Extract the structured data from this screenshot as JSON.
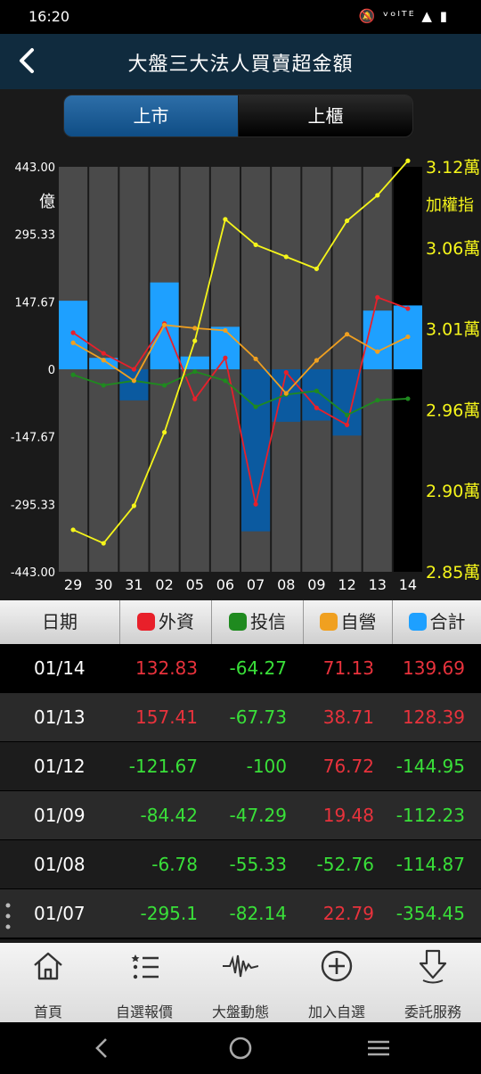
{
  "status": {
    "time": "16:20",
    "icons": "🔕 ᵛᵒˡᵀᴱ ▲ ▮"
  },
  "header": {
    "title": "大盤三大法人買賣超金額"
  },
  "segments": {
    "listed": "上市",
    "otc": "上櫃"
  },
  "chart_data": {
    "type": "bar",
    "categories": [
      "29",
      "30",
      "31",
      "02",
      "05",
      "06",
      "07",
      "08",
      "09",
      "12",
      "13",
      "14"
    ],
    "ylabel": "億",
    "yticks": [
      "443.00",
      "295.33",
      "147.67",
      "0",
      "-147.67",
      "-295.33",
      "-443.00"
    ],
    "ylim": [
      -443,
      443
    ],
    "y2label": "加權指",
    "y2ticks": [
      "3.12萬",
      "3.06萬",
      "3.01萬",
      "2.96萬",
      "2.90萬",
      "2.85萬"
    ],
    "y2lim": [
      28500,
      31200
    ],
    "series": [
      {
        "name": "合計",
        "type": "bar",
        "color": "#1ea0ff",
        "values": [
          150,
          25,
          -68,
          190,
          28,
          93,
          -354.45,
          -114.87,
          -112.23,
          -144.95,
          128.39,
          139.69
        ]
      },
      {
        "name": "外資",
        "type": "line",
        "color": "#e8202a",
        "values": [
          80,
          35,
          0,
          100,
          -65,
          25,
          -295.1,
          -6.78,
          -84.42,
          -121.67,
          157.41,
          132.83
        ]
      },
      {
        "name": "投信",
        "type": "line",
        "color": "#1f8a1f",
        "values": [
          -12,
          -35,
          -25,
          -35,
          -5,
          -25,
          -82.14,
          -55.33,
          -47.29,
          -100,
          -67.73,
          -64.27
        ]
      },
      {
        "name": "自營",
        "type": "line",
        "color": "#f0a020",
        "values": [
          58,
          20,
          -25,
          97,
          90,
          85,
          22.79,
          -52.76,
          19.48,
          76.72,
          38.71,
          71.13
        ]
      },
      {
        "name": "加權指",
        "type": "line",
        "axis": "right",
        "color": "#f5f51a",
        "values": [
          28780,
          28690,
          28940,
          29430,
          30040,
          30850,
          30680,
          30600,
          30520,
          30840,
          31010,
          31240
        ]
      }
    ],
    "highlight_category": "14"
  },
  "table": {
    "headers": [
      {
        "label": "日期"
      },
      {
        "label": "外資",
        "color": "#e8202a"
      },
      {
        "label": "投信",
        "color": "#1f8a1f"
      },
      {
        "label": "自營",
        "color": "#f0a020"
      },
      {
        "label": "合計",
        "color": "#1ea0ff"
      }
    ],
    "rows": [
      {
        "date": "01/14",
        "foreign": "132.83",
        "trust": "-64.27",
        "dealer": "71.13",
        "total": "139.69"
      },
      {
        "date": "01/13",
        "foreign": "157.41",
        "trust": "-67.73",
        "dealer": "38.71",
        "total": "128.39"
      },
      {
        "date": "01/12",
        "foreign": "-121.67",
        "trust": "-100",
        "dealer": "76.72",
        "total": "-144.95"
      },
      {
        "date": "01/09",
        "foreign": "-84.42",
        "trust": "-47.29",
        "dealer": "19.48",
        "total": "-112.23"
      },
      {
        "date": "01/08",
        "foreign": "-6.78",
        "trust": "-55.33",
        "dealer": "-52.76",
        "total": "-114.87"
      },
      {
        "date": "01/07",
        "foreign": "-295.1",
        "trust": "-82.14",
        "dealer": "22.79",
        "total": "-354.45"
      }
    ]
  },
  "tabbar": {
    "items": [
      {
        "label": "首頁",
        "icon": "home-icon"
      },
      {
        "label": "自選報價",
        "icon": "list-icon"
      },
      {
        "label": "大盤動態",
        "icon": "pulse-icon"
      },
      {
        "label": "加入自選",
        "icon": "plus-circle-icon"
      },
      {
        "label": "委託服務",
        "icon": "download-arrow-icon"
      }
    ]
  }
}
